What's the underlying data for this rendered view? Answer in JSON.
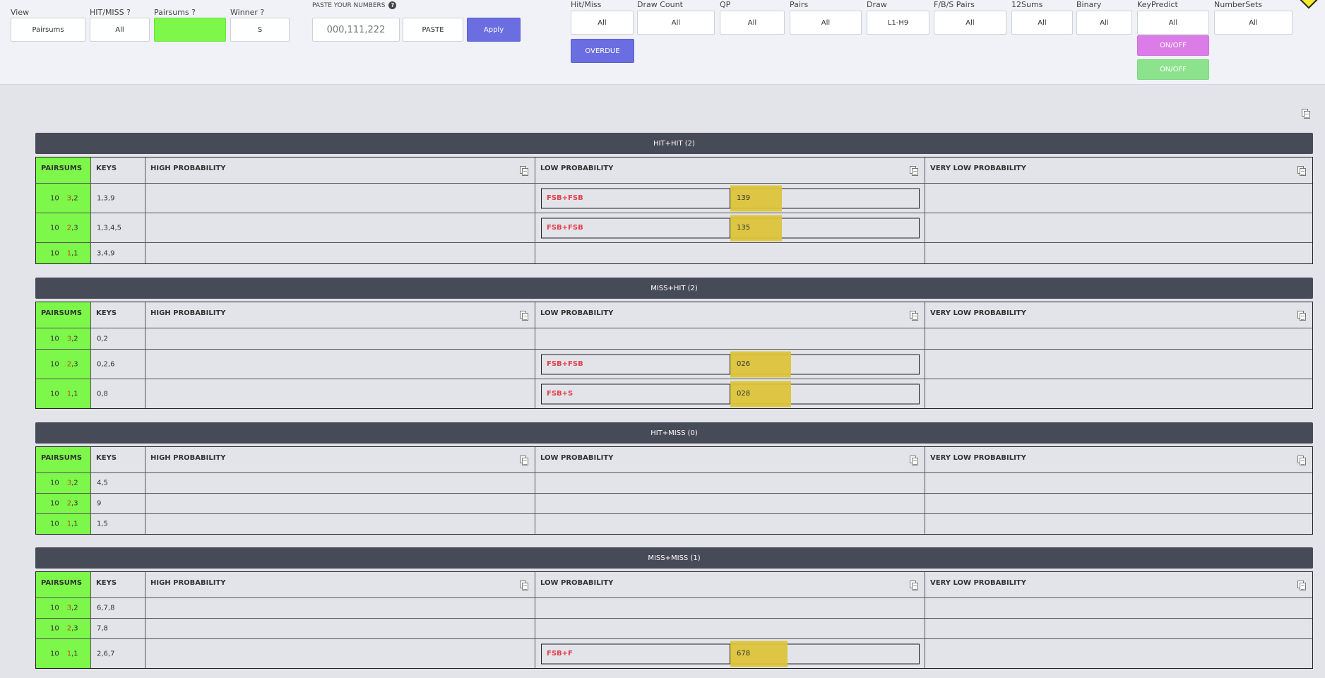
{
  "filters_left": [
    {
      "id": "view",
      "label": "View",
      "value": "Pairsums"
    },
    {
      "id": "hitmiss",
      "label": "HIT/MISS ?",
      "value": "All"
    },
    {
      "id": "pairsums",
      "label": "Pairsums ?",
      "value": ""
    },
    {
      "id": "winner",
      "label": "Winner ?",
      "value": "S"
    }
  ],
  "paste": {
    "label": "PASTE YOUR NUMBERS",
    "placeholder": "000,111,222",
    "paste_button": "PASTE",
    "apply_button": "Apply"
  },
  "filters_right": [
    {
      "id": "hitmiss2",
      "label": "Hit/Miss",
      "value": "All"
    },
    {
      "id": "drawcount",
      "label": "Draw Count",
      "value": "All"
    },
    {
      "id": "qp",
      "label": "QP",
      "value": "All"
    },
    {
      "id": "pairs",
      "label": "Pairs",
      "value": "All"
    },
    {
      "id": "draw",
      "label": "Draw",
      "value": "L1-H9"
    },
    {
      "id": "fbs",
      "label": "F/B/S Pairs",
      "value": "All"
    },
    {
      "id": "sums12",
      "label": "12Sums",
      "value": "All"
    },
    {
      "id": "binary",
      "label": "Binary",
      "value": "All"
    },
    {
      "id": "keypredict",
      "label": "KeyPredict",
      "value": "All"
    },
    {
      "id": "numbersets",
      "label": "NumberSets",
      "value": "All"
    }
  ],
  "buttons": {
    "overdue": "OVERDUE",
    "onoff_1": "ON/OFF",
    "onoff_2": "ON/OFF"
  },
  "columns": {
    "pairsums": "PAIRSUMS",
    "keys": "KEYS",
    "high": "HIGH PROBABILITY",
    "low": "LOW PROBABILITY",
    "very_low": "VERY LOW PROBABILITY"
  },
  "sections": [
    {
      "title": "HIT+HIT (2)",
      "rows": [
        {
          "sum": "10",
          "pa": "3",
          "pb": ",2",
          "keys": "1,3,9",
          "low": {
            "label": "FSB+FSB",
            "value": "139",
            "fill": 0.27
          }
        },
        {
          "sum": "10",
          "pa": "2",
          "pb": ",3",
          "keys": "1,3,4,5",
          "low": {
            "label": "FSB+FSB",
            "value": "135",
            "fill": 0.27
          }
        },
        {
          "sum": "10",
          "pa": "1",
          "pb": ",1",
          "keys": "3,4,9",
          "low": null
        }
      ]
    },
    {
      "title": "MISS+HIT (2)",
      "rows": [
        {
          "sum": "10",
          "pa": "3",
          "pb": ",2",
          "keys": "0,2",
          "low": null
        },
        {
          "sum": "10",
          "pa": "2",
          "pb": ",3",
          "keys": "0,2,6",
          "low": {
            "label": "FSB+FSB",
            "value": "026",
            "fill": 0.32
          }
        },
        {
          "sum": "10",
          "pa": "1",
          "pb": ",1",
          "keys": "0,8",
          "low": {
            "label": "FSB+S",
            "value": "028",
            "fill": 0.32
          }
        }
      ]
    },
    {
      "title": "HIT+MISS (0)",
      "rows": [
        {
          "sum": "10",
          "pa": "3",
          "pb": ",2",
          "keys": "4,5",
          "low": null
        },
        {
          "sum": "10",
          "pa": "2",
          "pb": ",3",
          "keys": "9",
          "low": null
        },
        {
          "sum": "10",
          "pa": "1",
          "pb": ",1",
          "keys": "1,5",
          "low": null
        }
      ]
    },
    {
      "title": "MISS+MISS (1)",
      "rows": [
        {
          "sum": "10",
          "pa": "3",
          "pb": ",2",
          "keys": "6,7,8",
          "low": null
        },
        {
          "sum": "10",
          "pa": "2",
          "pb": ",3",
          "keys": "7,8",
          "low": null
        },
        {
          "sum": "10",
          "pa": "1",
          "pb": ",1",
          "keys": "2,6,7",
          "low": {
            "label": "FSB+F",
            "value": "678",
            "fill": 0.3
          }
        }
      ]
    }
  ],
  "colors": {
    "accent": "#6a6ee0",
    "pairsum_green": "#7cf74a",
    "highlight": "#dcc43a",
    "fsb_red": "#e0404a"
  }
}
